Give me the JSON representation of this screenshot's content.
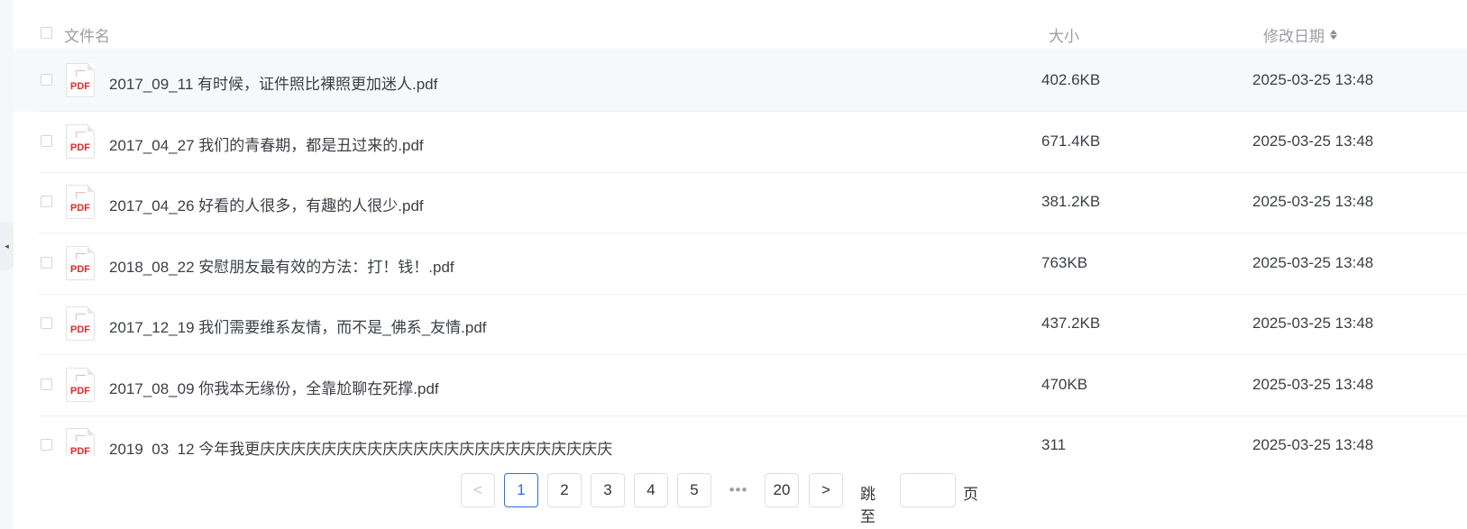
{
  "header": {
    "name_label": "文件名",
    "size_label": "大小",
    "date_label": "修改日期",
    "sort_icon": "sort-icon"
  },
  "files": [
    {
      "name": "2017_09_11 有时候，证件照比裸照更加迷人.pdf",
      "size": "402.6KB",
      "date": "2025-03-25 13:48",
      "icon": "PDF"
    },
    {
      "name": "2017_04_27 我们的青春期，都是丑过来的.pdf",
      "size": "671.4KB",
      "date": "2025-03-25 13:48",
      "icon": "PDF"
    },
    {
      "name": "2017_04_26 好看的人很多，有趣的人很少.pdf",
      "size": "381.2KB",
      "date": "2025-03-25 13:48",
      "icon": "PDF"
    },
    {
      "name": "2018_08_22 安慰朋友最有效的方法：打！钱！.pdf",
      "size": "763KB",
      "date": "2025-03-25 13:48",
      "icon": "PDF"
    },
    {
      "name": "2017_12_19 我们需要维系友情，而不是_佛系_友情.pdf",
      "size": "437.2KB",
      "date": "2025-03-25 13:48",
      "icon": "PDF"
    },
    {
      "name": "2017_08_09 你我本无缘份，全靠尬聊在死撑.pdf",
      "size": "470KB",
      "date": "2025-03-25 13:48",
      "icon": "PDF"
    },
    {
      "name": "2019_03_12 今年我更庆庆庆庆庆庆庆庆庆庆庆庆庆庆庆庆庆庆庆庆庆庆庆",
      "size": "311",
      "date": "2025-03-25 13:48",
      "icon": "PDF"
    }
  ],
  "pagination": {
    "prev": "<",
    "pages": [
      "1",
      "2",
      "3",
      "4",
      "5"
    ],
    "ellipsis": "•••",
    "last": "20",
    "next": ">",
    "jump_label": "跳至",
    "page_suffix": "页",
    "current": "1"
  },
  "side": {
    "collapse_icon": "◂"
  }
}
